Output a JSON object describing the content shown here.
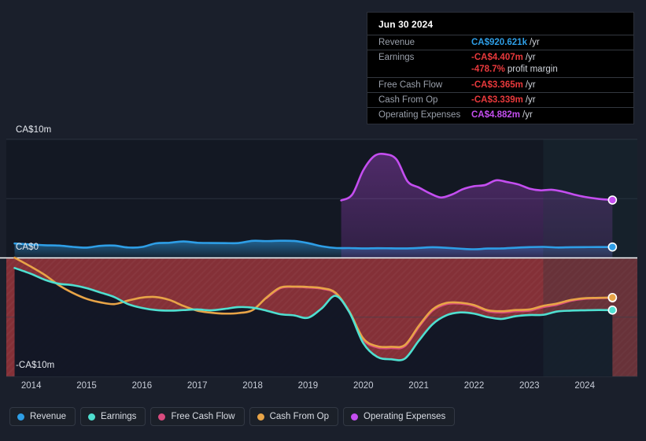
{
  "chart_data": {
    "type": "area",
    "title": "",
    "xlabel": "",
    "ylabel": "",
    "currency": "CA$",
    "xlim": [
      2013.55,
      2024.95
    ],
    "ylim": [
      -10,
      10
    ],
    "ylim_labels": [
      "-CA$10m",
      "CA$0",
      "CA$10m"
    ],
    "y_ticks": [
      10,
      5,
      0,
      -5,
      -10
    ],
    "y_tick_labels": [
      "CA$10m",
      "",
      "CA$0",
      "",
      "-CA$10m"
    ],
    "grid": true,
    "legend_position": "bottom-left",
    "x_tick_labels": [
      "2014",
      "2015",
      "2016",
      "2017",
      "2018",
      "2019",
      "2020",
      "2021",
      "2022",
      "2023",
      "2024"
    ],
    "x_ticks": [
      2014,
      2015,
      2016,
      2017,
      2018,
      2019,
      2020,
      2021,
      2022,
      2023,
      2024
    ],
    "series": [
      {
        "name": "Revenue",
        "color": "#2e9ee6",
        "fill": "#15415f",
        "x": [
          2013.7,
          2014.0,
          2014.25,
          2014.5,
          2014.75,
          2015.0,
          2015.25,
          2015.5,
          2015.75,
          2016.0,
          2016.25,
          2016.5,
          2016.75,
          2017.0,
          2017.25,
          2017.5,
          2017.75,
          2018.0,
          2018.25,
          2018.5,
          2018.75,
          2019.0,
          2019.25,
          2019.5,
          2019.75,
          2020.0,
          2020.25,
          2020.5,
          2020.75,
          2021.0,
          2021.25,
          2021.5,
          2021.75,
          2022.0,
          2022.25,
          2022.5,
          2022.75,
          2023.0,
          2023.25,
          2023.5,
          2023.75,
          2024.0,
          2024.25,
          2024.5
        ],
        "values": [
          1.22,
          1.13,
          1.07,
          1.04,
          0.93,
          0.87,
          1.02,
          1.04,
          0.88,
          0.92,
          1.23,
          1.28,
          1.39,
          1.28,
          1.26,
          1.25,
          1.26,
          1.44,
          1.42,
          1.45,
          1.43,
          1.25,
          0.98,
          0.84,
          0.83,
          0.8,
          0.82,
          0.81,
          0.8,
          0.84,
          0.9,
          0.85,
          0.78,
          0.73,
          0.79,
          0.8,
          0.86,
          0.91,
          0.93,
          0.88,
          0.9,
          0.91,
          0.92,
          0.921
        ]
      },
      {
        "name": "Earnings",
        "color": "#4fdfd0",
        "fill": "#0d2d33",
        "x": [
          2013.7,
          2014.0,
          2014.25,
          2014.5,
          2014.75,
          2015.0,
          2015.25,
          2015.5,
          2015.75,
          2016.0,
          2016.25,
          2016.5,
          2016.75,
          2017.0,
          2017.25,
          2017.5,
          2017.75,
          2018.0,
          2018.25,
          2018.5,
          2018.75,
          2019.0,
          2019.25,
          2019.5,
          2019.75,
          2020.0,
          2020.25,
          2020.5,
          2020.75,
          2021.0,
          2021.25,
          2021.5,
          2021.75,
          2022.0,
          2022.25,
          2022.5,
          2022.75,
          2023.0,
          2023.25,
          2023.5,
          2023.75,
          2024.0,
          2024.25,
          2024.5
        ],
        "values": [
          -0.85,
          -1.35,
          -1.85,
          -2.18,
          -2.3,
          -2.55,
          -2.92,
          -3.3,
          -3.9,
          -4.22,
          -4.4,
          -4.45,
          -4.4,
          -4.35,
          -4.42,
          -4.3,
          -4.15,
          -4.2,
          -4.45,
          -4.75,
          -4.85,
          -5.05,
          -4.25,
          -3.2,
          -4.6,
          -7.2,
          -8.35,
          -8.55,
          -8.5,
          -7.0,
          -5.6,
          -4.85,
          -4.6,
          -4.7,
          -5.0,
          -5.15,
          -4.92,
          -4.82,
          -4.8,
          -4.52,
          -4.45,
          -4.42,
          -4.4,
          -4.407
        ]
      },
      {
        "name": "Free Cash Flow",
        "color": "#d94b7e",
        "fill": "#3a1726",
        "x": [
          2018.25,
          2018.5,
          2018.75,
          2019.0,
          2019.25,
          2019.5,
          2019.75,
          2020.0,
          2020.25,
          2020.5,
          2020.75,
          2021.0,
          2021.25,
          2021.5,
          2021.75,
          2022.0,
          2022.25,
          2022.5,
          2022.75,
          2023.0,
          2023.25,
          2023.5,
          2023.75,
          2024.0,
          2024.25,
          2024.5
        ],
        "values": [
          -3.4,
          -2.55,
          -2.45,
          -2.5,
          -2.6,
          -3.0,
          -4.6,
          -6.9,
          -7.55,
          -7.6,
          -7.45,
          -5.85,
          -4.45,
          -3.9,
          -3.85,
          -4.05,
          -4.5,
          -4.6,
          -4.5,
          -4.45,
          -4.15,
          -3.95,
          -3.62,
          -3.45,
          -3.4,
          -3.365
        ]
      },
      {
        "name": "Cash From Op",
        "color": "#e8a447",
        "fill": "#3a2a16",
        "x": [
          2013.7,
          2014.0,
          2014.25,
          2014.5,
          2014.75,
          2015.0,
          2015.25,
          2015.5,
          2015.75,
          2016.0,
          2016.25,
          2016.5,
          2016.75,
          2017.0,
          2017.25,
          2017.5,
          2017.75,
          2018.0,
          2018.25,
          2018.5,
          2018.75,
          2019.0,
          2019.25,
          2019.5,
          2019.75,
          2020.0,
          2020.25,
          2020.5,
          2020.75,
          2021.0,
          2021.25,
          2021.5,
          2021.75,
          2022.0,
          2022.25,
          2022.5,
          2022.75,
          2023.0,
          2023.25,
          2023.5,
          2023.75,
          2024.0,
          2024.25,
          2024.5
        ],
        "values": [
          0.02,
          -0.75,
          -1.45,
          -2.3,
          -2.95,
          -3.45,
          -3.75,
          -3.9,
          -3.6,
          -3.35,
          -3.3,
          -3.55,
          -4.05,
          -4.45,
          -4.62,
          -4.7,
          -4.65,
          -4.4,
          -3.35,
          -2.5,
          -2.42,
          -2.45,
          -2.55,
          -2.95,
          -4.55,
          -6.8,
          -7.45,
          -7.5,
          -7.35,
          -5.75,
          -4.35,
          -3.8,
          -3.78,
          -3.98,
          -4.42,
          -4.5,
          -4.4,
          -4.35,
          -4.05,
          -3.85,
          -3.55,
          -3.4,
          -3.37,
          -3.339
        ]
      },
      {
        "name": "Operating Expenses",
        "color": "#c44ef0",
        "fill": "#3a2154",
        "x": [
          2019.6,
          2019.8,
          2020.0,
          2020.2,
          2020.4,
          2020.6,
          2020.8,
          2021.0,
          2021.2,
          2021.4,
          2021.6,
          2021.8,
          2022.0,
          2022.2,
          2022.4,
          2022.6,
          2022.8,
          2023.0,
          2023.2,
          2023.4,
          2023.6,
          2023.8,
          2024.0,
          2024.25,
          2024.5
        ],
        "values": [
          4.85,
          5.35,
          7.4,
          8.6,
          8.75,
          8.3,
          6.45,
          5.95,
          5.45,
          5.1,
          5.35,
          5.8,
          6.05,
          6.15,
          6.55,
          6.4,
          6.2,
          5.85,
          5.7,
          5.75,
          5.6,
          5.35,
          5.15,
          4.98,
          4.882
        ]
      }
    ],
    "highlight_band": {
      "from": 2023.25,
      "to": 2024.95,
      "color": "#1f3a42"
    },
    "negative_band_color": "#8e3239"
  },
  "tooltip": {
    "date": "Jun 30 2024",
    "rows": [
      {
        "key": "Revenue",
        "value": "CA$920.621k",
        "suffix": "/yr",
        "color": "#2e9ee6"
      },
      {
        "key": "Earnings",
        "value": "-CA$4.407m",
        "suffix": "/yr",
        "color": "#e8393c"
      },
      {
        "key": "",
        "value": "-478.7%",
        "suffix": "profit margin",
        "color": "#e8393c"
      },
      {
        "key": "Free Cash Flow",
        "value": "-CA$3.365m",
        "suffix": "/yr",
        "color": "#e8393c"
      },
      {
        "key": "Cash From Op",
        "value": "-CA$3.339m",
        "suffix": "/yr",
        "color": "#e8393c"
      },
      {
        "key": "Operating Expenses",
        "value": "CA$4.882m",
        "suffix": "/yr",
        "color": "#c44ef0"
      }
    ]
  },
  "legend": {
    "items": [
      {
        "label": "Revenue",
        "color": "#2e9ee6"
      },
      {
        "label": "Earnings",
        "color": "#4fdfd0"
      },
      {
        "label": "Free Cash Flow",
        "color": "#d94b7e"
      },
      {
        "label": "Cash From Op",
        "color": "#e8a447"
      },
      {
        "label": "Operating Expenses",
        "color": "#c44ef0"
      }
    ]
  }
}
